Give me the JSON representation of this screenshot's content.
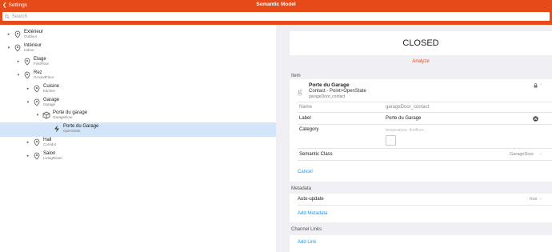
{
  "header": {
    "back_label": "Settings",
    "title": "Semantic Model"
  },
  "search": {
    "placeholder": "Search"
  },
  "tree": [
    {
      "name": "Extérieur",
      "sub": "Outdoor",
      "toggle": "▸",
      "icon": "location-pin-icon"
    },
    {
      "name": "Intérieur",
      "sub": "Indoor",
      "toggle": "▾",
      "icon": "location-pin-icon"
    },
    {
      "name": "Etage",
      "sub": "FirstFloor",
      "toggle": "▸",
      "icon": "location-pin-icon"
    },
    {
      "name": "Rez",
      "sub": "GroundFloor",
      "toggle": "▾",
      "icon": "location-pin-icon"
    },
    {
      "name": "Cuisine",
      "sub": "Kitchen",
      "toggle": "▸",
      "icon": "location-pin-icon"
    },
    {
      "name": "Garage",
      "sub": "Garage",
      "toggle": "▾",
      "icon": "location-pin-icon"
    },
    {
      "name": "Porte du garage",
      "sub": "GarageDoor",
      "toggle": "▾",
      "icon": "cube-icon"
    },
    {
      "name": "Porte du Garage",
      "sub": "OpenState",
      "toggle": "",
      "icon": "lightning-icon"
    },
    {
      "name": "Hall",
      "sub": "Corridor",
      "toggle": "▸",
      "icon": "location-pin-icon"
    },
    {
      "name": "Salon",
      "sub": "LivingRoom",
      "toggle": "▸",
      "icon": "location-pin-icon"
    }
  ],
  "state": {
    "value": "CLOSED",
    "analyze_label": "Analyze"
  },
  "item": {
    "section_title": "Item",
    "header": {
      "icon_letter": "g",
      "name": "Porte du Garage",
      "type": "Contact - Point>OpenState",
      "id": "garageDoor_contact"
    },
    "fields": {
      "name_label": "Name",
      "name_value": "garageDoor_contact",
      "label_label": "Label",
      "label_value": "Porte du Garage",
      "category_label": "Category",
      "category_placeholder": "temperature, firstfloor...",
      "semantic_label": "Semantic Class",
      "semantic_value": "GarageDoor"
    },
    "cancel_label": "Cancel"
  },
  "metadata": {
    "section_title": "Metadata",
    "auto_update_label": "Auto-update",
    "auto_update_value": "true",
    "add_label": "Add Metadata"
  },
  "channel_links": {
    "section_title": "Channel Links",
    "add_label": "Add Link"
  },
  "colors": {
    "accent": "#e64a19",
    "link": "#2196f3",
    "selected": "#d3e5f8"
  }
}
